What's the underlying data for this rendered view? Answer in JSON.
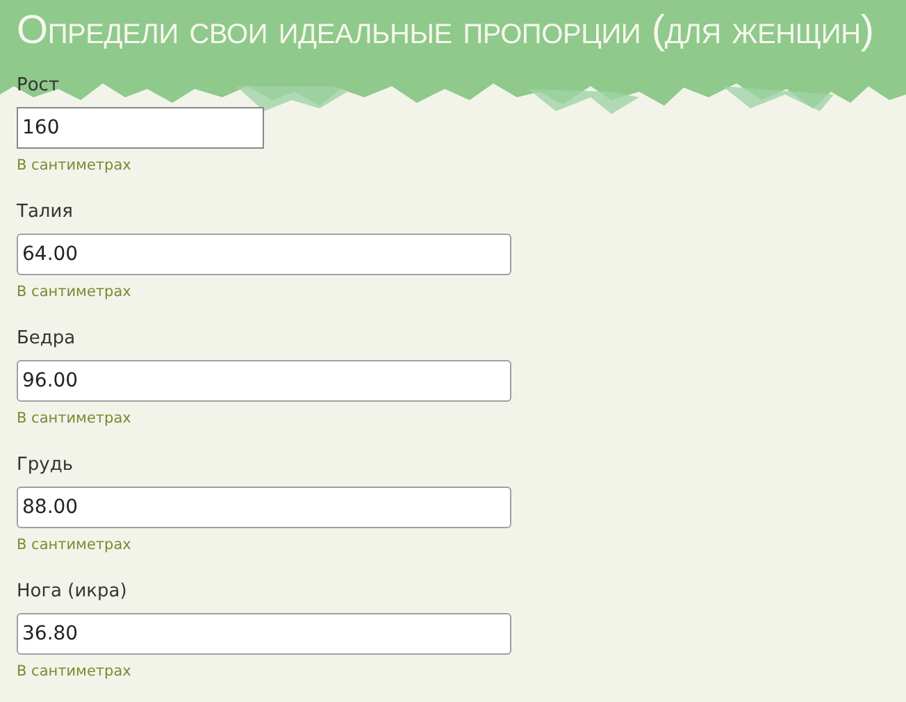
{
  "title": "Определи свои идеальные пропорции (для женщин)",
  "fields": [
    {
      "label": "Рост",
      "value": "160",
      "hint": "В сантиметрах",
      "kind": "short"
    },
    {
      "label": "Талия",
      "value": "64.00",
      "hint": "В сантиметрах",
      "kind": "wide"
    },
    {
      "label": "Бедра",
      "value": "96.00",
      "hint": "В сантиметрах",
      "kind": "wide"
    },
    {
      "label": "Грудь",
      "value": "88.00",
      "hint": "В сантиметрах",
      "kind": "wide"
    },
    {
      "label": "Нога (икра)",
      "value": "36.80",
      "hint": "В сантиметрах",
      "kind": "wide"
    }
  ]
}
